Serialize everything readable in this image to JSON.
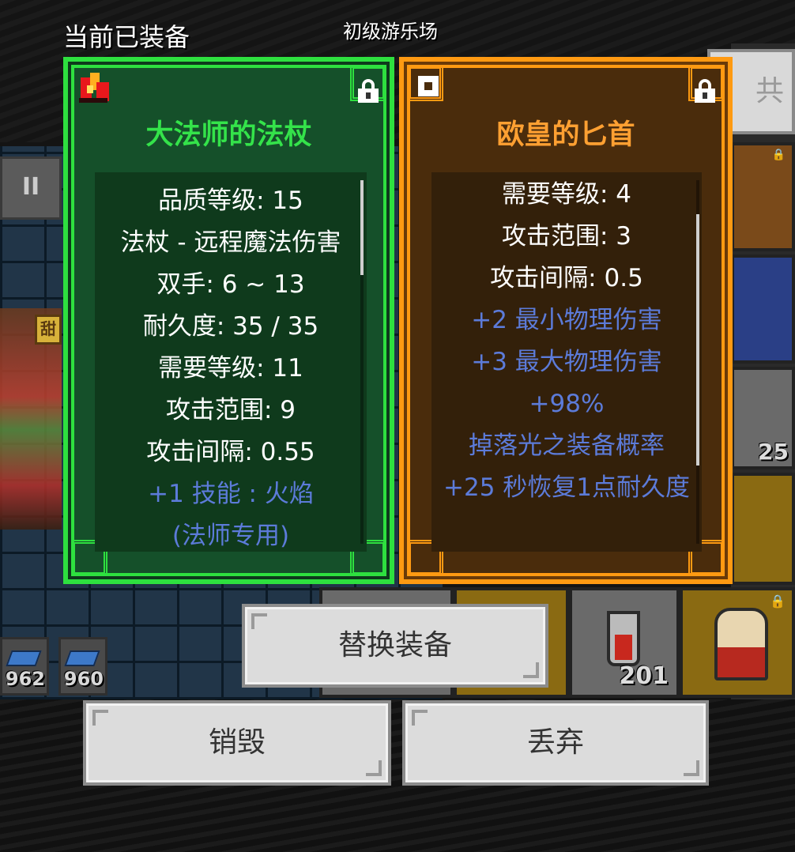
{
  "header": {
    "equipped_label": "当前已装备",
    "area_label": "初级游乐场"
  },
  "equipped_item": {
    "name": "大法师的法杖",
    "icon": "fire-staff-icon",
    "locked": true,
    "color": "#2ee03f",
    "stats": [
      {
        "text": "品质等级: 15",
        "type": "base"
      },
      {
        "text": "法杖 - 远程魔法伤害",
        "type": "base"
      },
      {
        "text": "双手: 6 ~ 13",
        "type": "base"
      },
      {
        "text": "耐久度: 35 / 35",
        "type": "base"
      },
      {
        "text": "需要等级: 11",
        "type": "base"
      },
      {
        "text": "攻击范围: 9",
        "type": "base"
      },
      {
        "text": "攻击间隔: 0.55",
        "type": "base"
      },
      {
        "text": "+1 技能 : 火焰",
        "type": "affix"
      },
      {
        "text": "(法师专用)",
        "type": "affix"
      }
    ],
    "scroll_position": 0.0
  },
  "new_item": {
    "name": "欧皇的匕首",
    "locked": true,
    "color": "#ff9a12",
    "stats": [
      {
        "text": "需要等级: 4",
        "type": "base"
      },
      {
        "text": "攻击范围: 3",
        "type": "base"
      },
      {
        "text": "攻击间隔: 0.5",
        "type": "base"
      },
      {
        "text": "+2 最小物理伤害",
        "type": "affix"
      },
      {
        "text": "+3 最大物理伤害",
        "type": "affix"
      },
      {
        "text": "+98%",
        "type": "affix"
      },
      {
        "text": "掉落光之装备概率",
        "type": "affix"
      },
      {
        "text": "+25 秒恢复1点耐久度",
        "type": "affix"
      }
    ],
    "scroll_position": 0.3
  },
  "actions": {
    "replace_label": "替换装备",
    "destroy_label": "销毁",
    "discard_label": "丢弃"
  },
  "background": {
    "pause_label": "II",
    "hero_sign": "甜",
    "backpack_tab": "共",
    "ammo_counts": [
      "962",
      "960"
    ],
    "item_counts": [
      "25",
      "201"
    ],
    "accent_blue": "#5c7bd9"
  }
}
